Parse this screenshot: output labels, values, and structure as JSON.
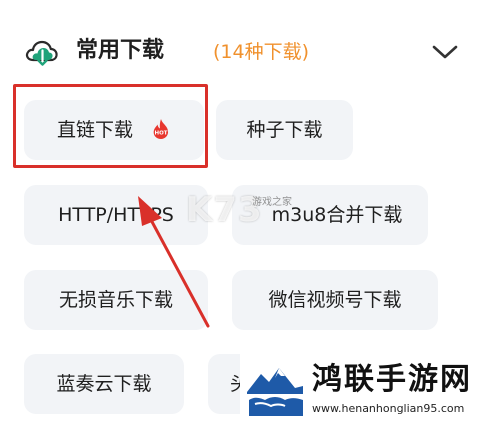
{
  "section": {
    "title": "常用下载",
    "count": "(14种下载)"
  },
  "chips": [
    {
      "label": "直链下载",
      "hot": true
    },
    {
      "label": "种子下载"
    },
    {
      "label": "HTTP/HTTPS"
    },
    {
      "label": "m3u8合并下载"
    },
    {
      "label": "无损音乐下载"
    },
    {
      "label": "微信视频号下载"
    },
    {
      "label": "蓝奏云下载"
    },
    {
      "label": "头"
    }
  ],
  "hot_badge_text": "HOT",
  "watermarks": {
    "k73": "K73",
    "k73_sub": "游戏之家",
    "site_name": "鸿联手游网",
    "site_url": "www.henanhonglian95.com"
  },
  "colors": {
    "accent_orange": "#f0912d",
    "highlight_red": "#d9302a",
    "chip_bg": "#f2f4f7",
    "cloud_green": "#1fa37a"
  },
  "icons": {
    "header": "cloud-download-icon",
    "expand": "chevron-down-icon",
    "hot": "hot-flame-icon"
  }
}
